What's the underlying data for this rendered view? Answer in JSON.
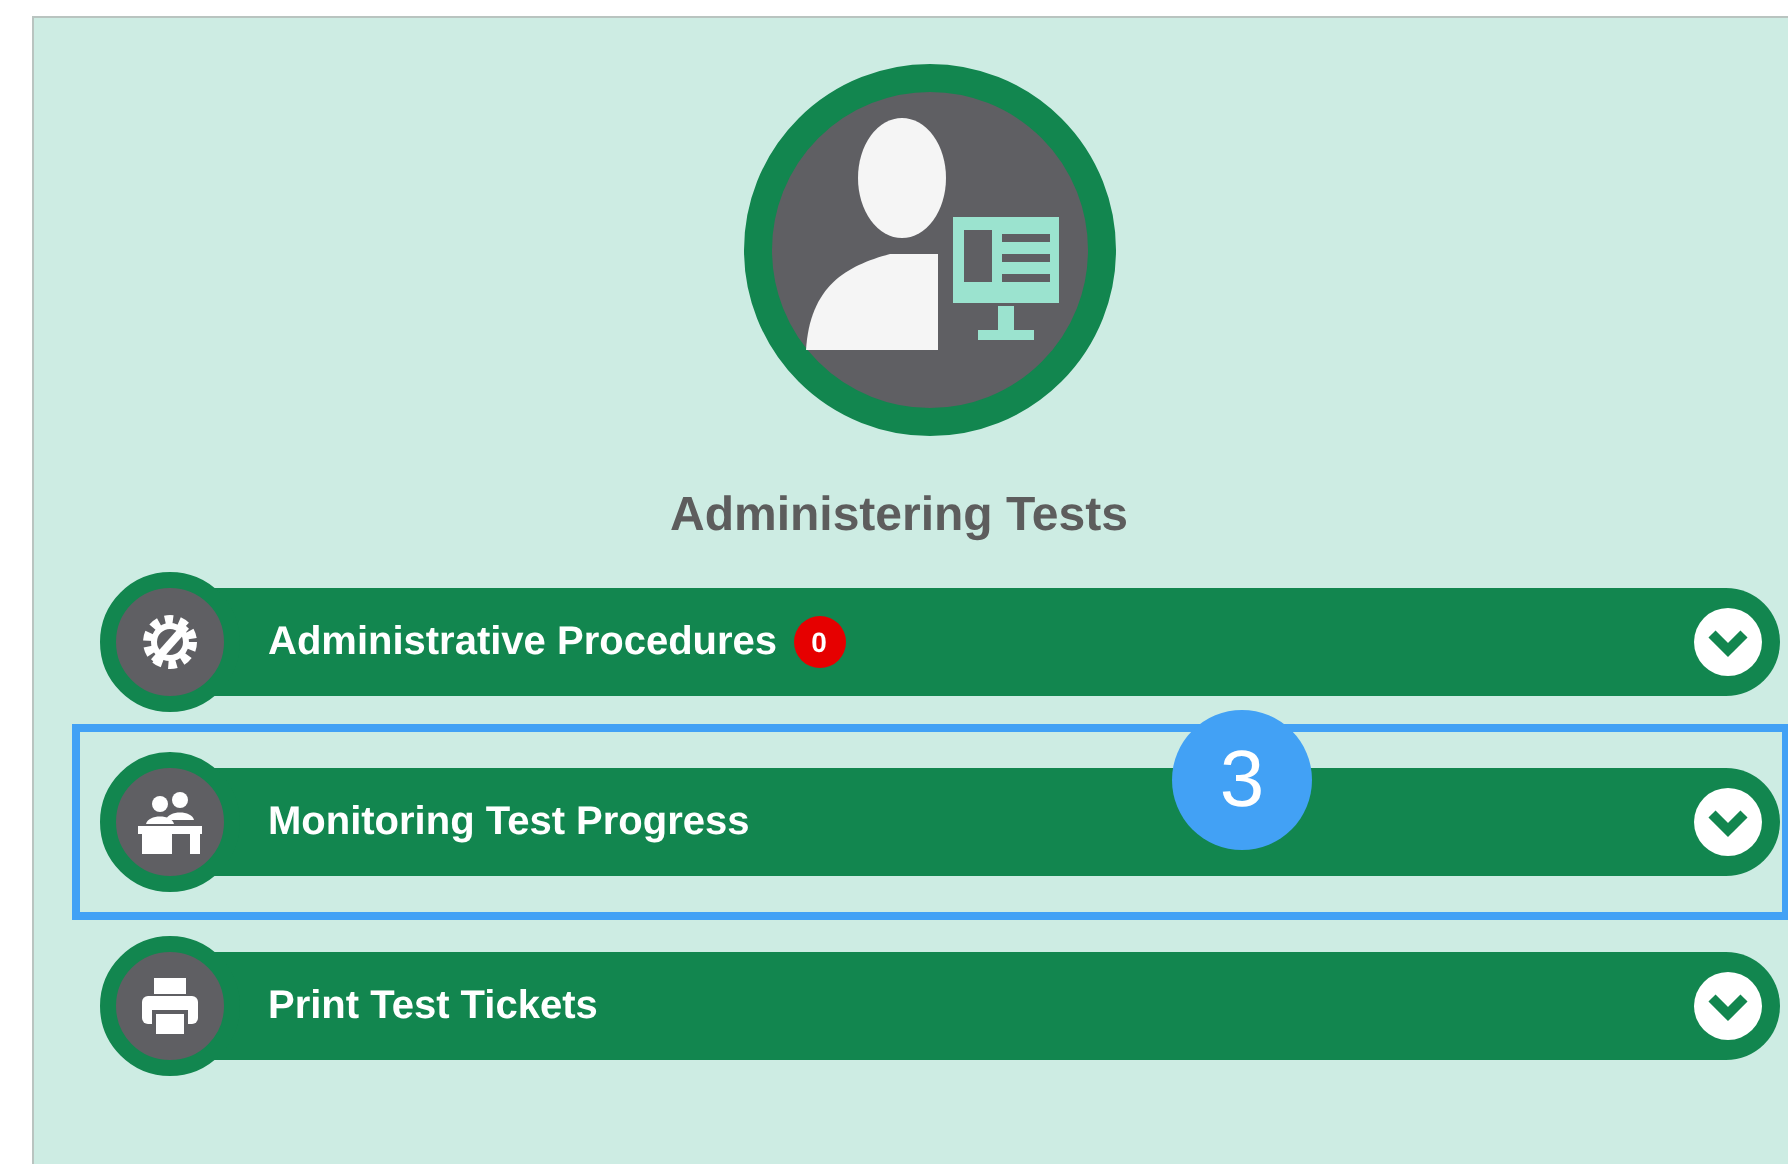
{
  "section": {
    "title": "Administering Tests"
  },
  "items": [
    {
      "label": "Administrative Procedures",
      "badge": "0",
      "highlighted": false
    },
    {
      "label": "Monitoring Test Progress",
      "highlighted": true,
      "callout": "3"
    },
    {
      "label": "Print Test Tickets",
      "highlighted": false
    }
  ]
}
